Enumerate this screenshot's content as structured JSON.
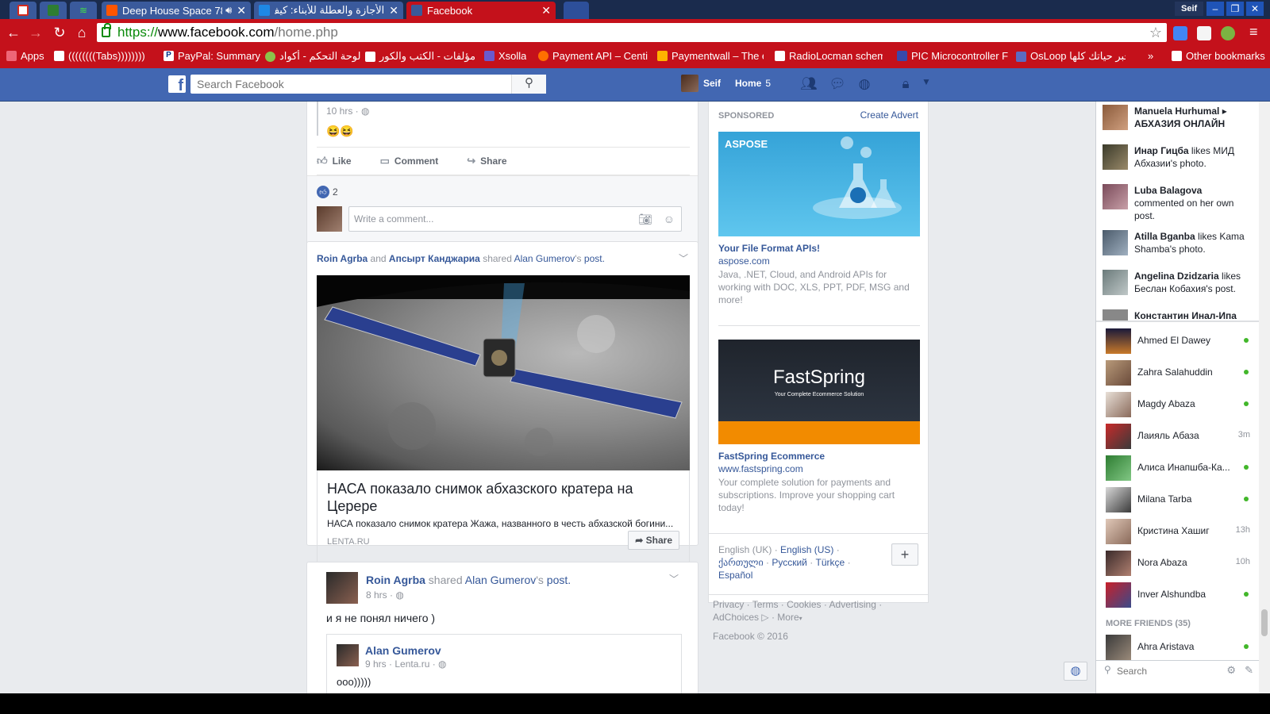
{
  "browser": {
    "tabs": [
      {
        "title": "",
        "icon_color": "#d52b1e",
        "pinned": true
      },
      {
        "title": "",
        "icon_color": "#2e7d32",
        "pinned": true
      },
      {
        "title": "",
        "icon_color": "#43a047",
        "pinned": true
      },
      {
        "title": "Deep House Space 78",
        "icon_color": "#ff5500",
        "audio": true
      },
      {
        "title": "الأجازة والعطلة للأبناء: كيف",
        "icon_color": "#1e88e5"
      },
      {
        "title": "Facebook",
        "icon_color": "#3b5998",
        "active": true
      }
    ],
    "profile_name": "Seif",
    "url": {
      "scheme": "https://",
      "domain": "www.facebook.com",
      "path": "/home.php"
    },
    "bookmarks": [
      {
        "label": "Apps"
      },
      {
        "label": "((((((((Tabs))))))))"
      },
      {
        "label": "PayPal: Summary"
      },
      {
        "label": "لوحة التحكم - أكواد"
      },
      {
        "label": "مؤلفات - الكتب والكور"
      },
      {
        "label": "Xsolla"
      },
      {
        "label": "Payment API – Centi"
      },
      {
        "label": "Paymentwall – The e"
      },
      {
        "label": "RadioLocman schem"
      },
      {
        "label": "PIC Microcontroller F"
      },
      {
        "label": "OsLoop خبر حياتك كلها"
      },
      {
        "label": "»"
      },
      {
        "label": "Other bookmarks"
      }
    ]
  },
  "fb_header": {
    "search_placeholder": "Search Facebook",
    "user_name": "Seif",
    "home_label": "Home",
    "home_count": "5"
  },
  "feed": {
    "post1": {
      "time": "10 hrs · ",
      "emoji": "😆😆",
      "like_label": "Like",
      "comment_label": "Comment",
      "share_label": "Share",
      "like_count": "2",
      "comment_placeholder": "Write a comment..."
    },
    "post2": {
      "actor1": "Roin Agrba",
      "and": " and ",
      "actor2": "Апсырт Канджариа",
      "shared": " shared ",
      "owner": "Alan Gumerov",
      "owner_suffix": "'s ",
      "post_word": "post.",
      "link_title": "НАСА показало снимок абхазского кратера на Церере",
      "link_desc": "НАСА показало снимок кратера Жажа, названного в честь абхазской богини...",
      "link_source": "LENTA.RU",
      "share_label": "Share"
    },
    "post3": {
      "actor": "Roin Agrba",
      "shared": " shared ",
      "owner": "Alan Gumerov",
      "owner_suffix": "'s ",
      "post_word": "post.",
      "time": "8 hrs · ",
      "text": "и я не понял ничего )",
      "inner_name": "Alan Gumerov",
      "inner_time": "9 hrs · Lenta.ru · ",
      "inner_text": "ооо)))))"
    }
  },
  "ads": {
    "sponsored_label": "SPONSORED",
    "create_advert": "Create Advert",
    "ad1": {
      "brand": "ASPOSE",
      "title": "Your File Format APIs!",
      "url": "aspose.com",
      "desc": "Java, .NET, Cloud, and Android APIs for working with DOC, XLS, PPT, PDF, MSG and more!"
    },
    "ad2": {
      "brand": "FastSpring",
      "tagline": "Your Complete Ecommerce Solution",
      "title": "FastSpring Ecommerce",
      "url": "www.fastspring.com",
      "desc": "Your complete solution for payments and subscriptions. Improve your shopping cart today!"
    }
  },
  "languages": {
    "current": "English (UK)",
    "options": [
      "English (US)",
      "ქართული",
      "Русский",
      "Türkçe",
      "Español"
    ]
  },
  "footer": {
    "links": [
      "Privacy",
      "Terms",
      "Cookies",
      "Advertising",
      "AdChoices",
      "More"
    ],
    "copyright": "Facebook © 2016"
  },
  "ticker": [
    {
      "name": "Manuela Hurhumal",
      "rest": "",
      "extra": "АБХАЗИЯ ОНЛАЙН"
    },
    {
      "name": "Инар Гицба",
      "rest": " likes МИД Абхазии's photo."
    },
    {
      "name": "Luba Balagova",
      "rest": " commented on her own post."
    },
    {
      "name": "Atilla Bganba",
      "rest": " likes Kama Shamba's photo."
    },
    {
      "name": "Angelina Dzidzaria",
      "rest": " likes Беслан Кобахия's post."
    },
    {
      "name": "Константин Инал-Ипа",
      "rest": ""
    }
  ],
  "chat": {
    "friends": [
      {
        "name": "Ahmed El Dawey",
        "status": "online"
      },
      {
        "name": "Zahra Salahuddin",
        "status": "online"
      },
      {
        "name": "Magdy Abaza",
        "status": "online"
      },
      {
        "name": "Лаияль Абаза",
        "status": "3m"
      },
      {
        "name": "Алиса Инапшба-Ка...",
        "status": "online"
      },
      {
        "name": "Milana Tarba",
        "status": "online"
      },
      {
        "name": "Кристина Хашиг",
        "status": "13h"
      },
      {
        "name": "Nora Abaza",
        "status": "10h"
      },
      {
        "name": "Inver Alshundba",
        "status": "online"
      }
    ],
    "more_friends": "MORE FRIENDS (35)",
    "more_list": [
      {
        "name": "Ahra Aristava",
        "status": "online"
      }
    ],
    "search_placeholder": "Search"
  },
  "colors": {
    "chrome_red": "#c4111b",
    "fb_blue": "#4267b2",
    "online_green": "#42b72a"
  }
}
